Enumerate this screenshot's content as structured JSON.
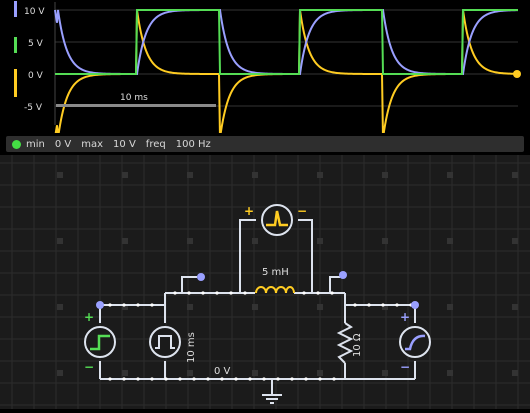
{
  "scope": {
    "y_ticks": [
      "10 V",
      "5 V",
      "0 V",
      "-5 V"
    ],
    "time_scale_label": "10 ms",
    "trace_colors": {
      "inductor": "#9aa0ff",
      "source": "#55dd55",
      "resistor": "#ffcc22"
    }
  },
  "info_bar": {
    "indicator_color": "#44dd44",
    "min_label": "min",
    "min_value": "0 V",
    "max_label": "max",
    "max_value": "10 V",
    "freq_label": "freq",
    "freq_value": "100 Hz"
  },
  "circuit": {
    "inductor_label": "5 mH",
    "source_label": "10 ms",
    "resistor_label": "10 Ω",
    "ground_label": "0 V",
    "plus_sign": "+",
    "minus_sign": "−"
  },
  "chart_data": {
    "type": "line",
    "y_ticks": [
      10,
      5,
      0,
      -5
    ],
    "ylim": [
      -6,
      12
    ],
    "period_ms": 10,
    "series": [
      {
        "color": "#55dd55",
        "shape": "square wave",
        "values": [
          0,
          10
        ]
      },
      {
        "color": "#9aa0ff",
        "shape": "exponential rise/fall toward source"
      },
      {
        "color": "#ffcc22",
        "shape": "decaying spikes",
        "peak": 10,
        "trough": -10
      }
    ]
  }
}
